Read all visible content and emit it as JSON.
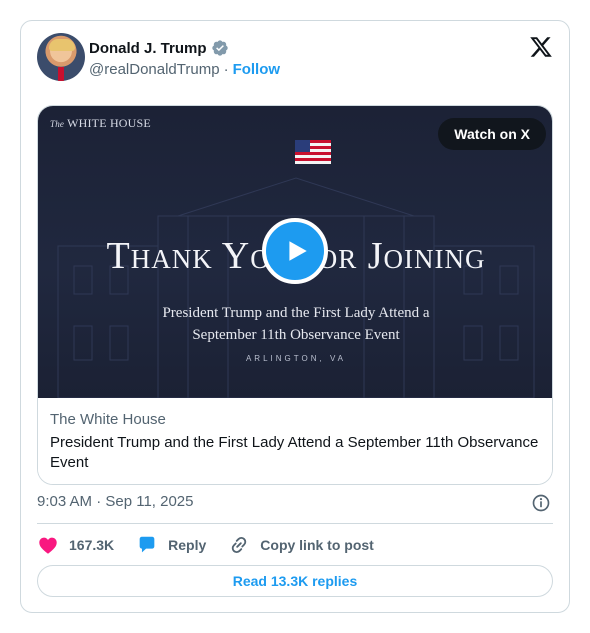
{
  "author": {
    "name": "Donald J. Trump",
    "handle": "@realDonaldTrump",
    "separator": "·",
    "follow_label": "Follow",
    "verified_icon": "verified-badge-icon"
  },
  "platform_icon": "x-logo-icon",
  "media": {
    "brand_prefix": "The",
    "brand_name": "WHITE HOUSE",
    "watch_label": "Watch on X",
    "headline": "Thank You for Joining",
    "subtitle_line1": "President Trump and the First Lady Attend a",
    "subtitle_line2": "September 11th Observance Event",
    "location": "ARLINGTON, VA",
    "play_icon": "play-icon"
  },
  "link_card": {
    "domain": "The White House",
    "title": "President Trump and the First Lady Attend a September 11th Observance Event"
  },
  "timestamp": "9:03 AM · Sep 11, 2025",
  "actions": {
    "likes": "167.3K",
    "reply_label": "Reply",
    "copy_label": "Copy link to post"
  },
  "replies_label": "Read 13.3K replies",
  "colors": {
    "accent": "#1d9bf0",
    "like": "#f91880",
    "text": "#0f1419",
    "secondary": "#536471",
    "border": "#cfd9de"
  }
}
